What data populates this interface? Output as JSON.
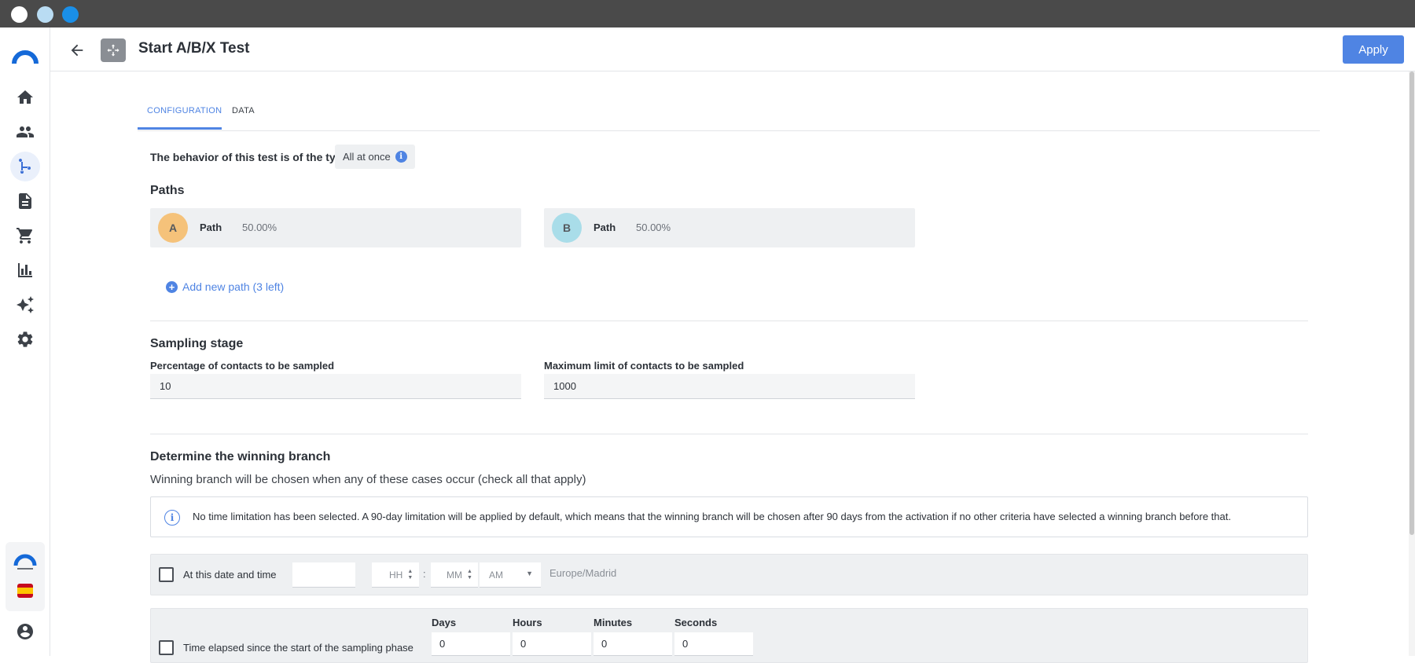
{
  "header": {
    "title": "Start A/B/X Test",
    "apply_label": "Apply"
  },
  "sidebar": {
    "items": [
      {
        "name": "home",
        "icon": "home-icon"
      },
      {
        "name": "contacts",
        "icon": "people-icon"
      },
      {
        "name": "automation",
        "icon": "branch-icon",
        "active": true
      },
      {
        "name": "documents",
        "icon": "document-icon"
      },
      {
        "name": "ecommerce",
        "icon": "cart-icon"
      },
      {
        "name": "reports",
        "icon": "bar-chart-icon"
      },
      {
        "name": "ai",
        "icon": "sparkles-icon"
      },
      {
        "name": "settings",
        "icon": "gear-icon"
      }
    ]
  },
  "tabs": [
    {
      "label": "CONFIGURATION",
      "active": true
    },
    {
      "label": "DATA",
      "active": false
    }
  ],
  "behavior": {
    "label": "The behavior of this test is of the type",
    "value": "All at once"
  },
  "paths": {
    "title": "Paths",
    "items": [
      {
        "letter": "A",
        "name": "Path",
        "percent": "50.00%",
        "color": "#f5c27a"
      },
      {
        "letter": "B",
        "name": "Path",
        "percent": "50.00%",
        "color": "#a9dde9"
      }
    ],
    "add_label": "Add new path (3 left)"
  },
  "sampling": {
    "title": "Sampling stage",
    "pct_label": "Percentage of contacts to be sampled",
    "pct_value": "10",
    "max_label": "Maximum limit of contacts to be sampled",
    "max_value": "1000"
  },
  "winning": {
    "title": "Determine the winning branch",
    "subtitle": "Winning branch will be chosen when any of these cases occur (check all that apply)",
    "info": "No time limitation has been selected. A 90-day limitation will be applied by default, which means that the winning branch will be chosen after 90 days from the activation if no other criteria have selected a winning branch before that.",
    "date_label": "At this date and time",
    "hh": "HH",
    "mm": "MM",
    "ampm": "AM",
    "timezone": "Europe/Madrid",
    "elapsed_label": "Time elapsed since the start of the sampling phase",
    "units": [
      {
        "label": "Days",
        "value": "0"
      },
      {
        "label": "Hours",
        "value": "0"
      },
      {
        "label": "Minutes",
        "value": "0"
      },
      {
        "label": "Seconds",
        "value": "0"
      }
    ]
  },
  "colors": {
    "accent": "#4f84e3",
    "titlebar": "#4a4a4a"
  }
}
